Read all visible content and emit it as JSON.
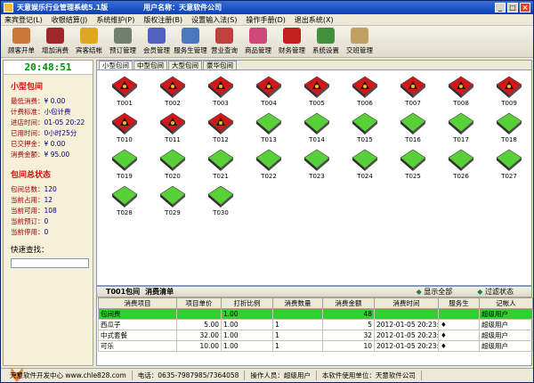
{
  "window": {
    "title": "天意娱乐行业管理系统5.1版",
    "owner": "用户名称：天意软件公司"
  },
  "menu": [
    "来宾登记(L)",
    "收银结算(J)",
    "系统维护(P)",
    "版权注册(B)",
    "设置输入法(S)",
    "操作手册(D)",
    "退出系统(X)"
  ],
  "toolbar": [
    {
      "label": "顾客开单",
      "icon": "customer-icon",
      "color": "#c87838"
    },
    {
      "label": "增加消费",
      "icon": "wine-icon",
      "color": "#a02828"
    },
    {
      "label": "宾客结帐",
      "icon": "coins-icon",
      "color": "#e0a820"
    },
    {
      "label": "预订管理",
      "icon": "clock-icon",
      "color": "#708070"
    },
    {
      "label": "会员管理",
      "icon": "member-icon",
      "color": "#5060c0"
    },
    {
      "label": "服务生管理",
      "icon": "staff-icon",
      "color": "#4878c0"
    },
    {
      "label": "营业查询",
      "icon": "query-icon",
      "color": "#c04040"
    },
    {
      "label": "商品管理",
      "icon": "goods-icon",
      "color": "#d04878"
    },
    {
      "label": "财务管理",
      "icon": "money-icon",
      "color": "#c02020"
    },
    {
      "label": "系统设置",
      "icon": "settings-icon",
      "color": "#409040"
    },
    {
      "label": "交班管理",
      "icon": "handshake-icon",
      "color": "#c0a060"
    }
  ],
  "clock": "20:48:51",
  "current_room": {
    "title": "小型包间",
    "rows": [
      {
        "k": "最低消费：",
        "v": "¥ 0.00"
      },
      {
        "k": "计费标准：",
        "v": "小包计费"
      },
      {
        "k": "进店时间：",
        "v": "01-05 20:22"
      },
      {
        "k": "已用时间：",
        "v": "0小时25分"
      },
      {
        "k": "已交押金：",
        "v": "¥ 0.00"
      },
      {
        "k": "消费金额：",
        "v": "¥ 95.00"
      }
    ]
  },
  "summary": {
    "title": "包间总状态",
    "rows": [
      {
        "k": "包间总数：",
        "v": "120"
      },
      {
        "k": "当前占用：",
        "v": "12"
      },
      {
        "k": "当前可用：",
        "v": "108"
      },
      {
        "k": "当前预订：",
        "v": "0"
      },
      {
        "k": "当前停用：",
        "v": "0"
      }
    ]
  },
  "search": {
    "label": "快速查找："
  },
  "tabs": [
    "小型包间",
    "中型包间",
    "大型包间",
    "豪华包间"
  ],
  "rooms": [
    {
      "id": "T001",
      "status": "occupied"
    },
    {
      "id": "T002",
      "status": "occupied"
    },
    {
      "id": "T003",
      "status": "occupied"
    },
    {
      "id": "T004",
      "status": "occupied"
    },
    {
      "id": "T005",
      "status": "occupied"
    },
    {
      "id": "T006",
      "status": "occupied"
    },
    {
      "id": "T007",
      "status": "occupied"
    },
    {
      "id": "T008",
      "status": "occupied"
    },
    {
      "id": "T009",
      "status": "occupied"
    },
    {
      "id": "T010",
      "status": "occupied"
    },
    {
      "id": "T011",
      "status": "occupied"
    },
    {
      "id": "T012",
      "status": "occupied"
    },
    {
      "id": "T013",
      "status": "free"
    },
    {
      "id": "T014",
      "status": "free"
    },
    {
      "id": "T015",
      "status": "free"
    },
    {
      "id": "T016",
      "status": "free"
    },
    {
      "id": "T017",
      "status": "free"
    },
    {
      "id": "T018",
      "status": "free"
    },
    {
      "id": "T019",
      "status": "free"
    },
    {
      "id": "T020",
      "status": "free"
    },
    {
      "id": "T021",
      "status": "free"
    },
    {
      "id": "T022",
      "status": "free"
    },
    {
      "id": "T023",
      "status": "free"
    },
    {
      "id": "T024",
      "status": "free"
    },
    {
      "id": "T025",
      "status": "free"
    },
    {
      "id": "T026",
      "status": "free"
    },
    {
      "id": "T027",
      "status": "free"
    },
    {
      "id": "T028",
      "status": "free"
    },
    {
      "id": "T029",
      "status": "free"
    },
    {
      "id": "T030",
      "status": "free"
    }
  ],
  "colors": {
    "occupied": "#d01818",
    "free": "#58d038",
    "selected_row": "#30d030"
  },
  "bill": {
    "room": "T001包间",
    "title": "消费清单",
    "show_all": "显示全部",
    "filter": "过滤状态",
    "columns": [
      "消费项目",
      "项目单价",
      "打折比例",
      "消费数量",
      "消费金额",
      "消费时间",
      "服务生",
      "记帐人"
    ],
    "rows": [
      [
        "包间费",
        "",
        "1.00",
        "",
        "48",
        "",
        "",
        "超级用户"
      ],
      [
        "西瓜子",
        "5.00",
        "1.00",
        "1",
        "5",
        "2012-01-05 20:23:28",
        "♦",
        "超级用户"
      ],
      [
        "中式套餐",
        "32.00",
        "1.00",
        "1",
        "32",
        "2012-01-05 20:23:28",
        "♦",
        "超级用户"
      ],
      [
        "可乐",
        "10.00",
        "1.00",
        "1",
        "10",
        "2012-01-05 20:23:28",
        "♦",
        "超级用户"
      ]
    ]
  },
  "status": [
    "天意软件开发中心 www.chle828.com",
    "电话：0635-7987985/7364058",
    "操作人员：超级用户",
    "本软件使用单位：天意软件公司"
  ]
}
